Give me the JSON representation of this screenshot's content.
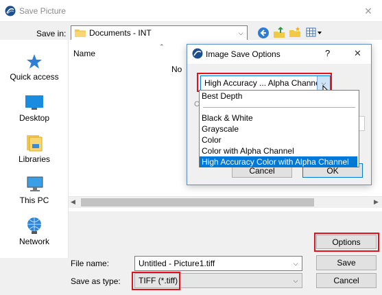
{
  "window": {
    "title": "Save Picture",
    "close_glyph": "✕"
  },
  "toolbar": {
    "save_in_label": "Save in:",
    "location": "Documents - INT",
    "icons": [
      "back-icon",
      "up-folder-icon",
      "new-folder-icon",
      "view-menu-icon"
    ]
  },
  "sidebar": {
    "items": [
      {
        "label": "Quick access",
        "icon": "quick-access-star-icon"
      },
      {
        "label": "Desktop",
        "icon": "desktop-icon"
      },
      {
        "label": "Libraries",
        "icon": "libraries-icon"
      },
      {
        "label": "This PC",
        "icon": "this-pc-icon"
      },
      {
        "label": "Network",
        "icon": "network-icon"
      }
    ]
  },
  "file_list": {
    "column_name": "Name",
    "empty_text": "No"
  },
  "dialog": {
    "title": "Image Save Options",
    "help_glyph": "?",
    "close_glyph": "✕",
    "selected_value": "High Accuracy ... Alpha Channel",
    "options": [
      "Best Depth",
      "Black & White",
      "Grayscale",
      "Color",
      "Color with Alpha Channel",
      "High Accuracy Color with Alpha Channel"
    ],
    "selected_index": 5,
    "partial_letter": "C",
    "cancel_label": "Cancel",
    "ok_label": "OK"
  },
  "bottom": {
    "options_label": "Options",
    "file_name_label": "File name:",
    "file_name_value": "Untitled - Picture1.tiff",
    "save_as_type_label": "Save as type:",
    "save_as_type_value": "TIFF (*.tiff)",
    "save_label": "Save",
    "cancel_label": "Cancel"
  },
  "colors": {
    "accent": "#0078d7",
    "highlight_box": "#e3111b",
    "dialog_border": "#5a8ec8"
  }
}
